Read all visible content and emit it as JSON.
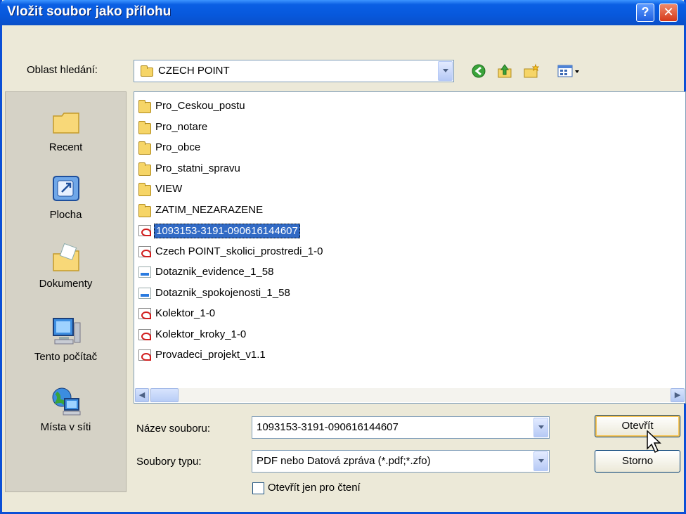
{
  "window": {
    "title": "Vložit soubor jako přílohu",
    "help_glyph": "?",
    "close_glyph": "✕"
  },
  "lookin": {
    "label": "Oblast hledání:",
    "value": "CZECH POINT"
  },
  "toolbar": {
    "icons": [
      "back-icon",
      "up-folder-icon",
      "new-folder-icon",
      "view-menu-icon"
    ]
  },
  "places": [
    {
      "label": "Recent",
      "icon": "recent-folder-icon"
    },
    {
      "label": "Plocha",
      "icon": "desktop-icon"
    },
    {
      "label": "Dokumenty",
      "icon": "documents-folder-icon"
    },
    {
      "label": "Tento počítač",
      "icon": "computer-icon"
    },
    {
      "label": "Místa v síti",
      "icon": "network-icon"
    }
  ],
  "files": [
    {
      "name": "Pro_Ceskou_postu",
      "type": "folder"
    },
    {
      "name": "Pro_notare",
      "type": "folder"
    },
    {
      "name": "Pro_obce",
      "type": "folder"
    },
    {
      "name": "Pro_statni_spravu",
      "type": "folder"
    },
    {
      "name": "VIEW",
      "type": "folder"
    },
    {
      "name": "ZATIM_NEZARAZENE",
      "type": "folder"
    },
    {
      "name": "1093153-3191-090616144607",
      "type": "pdf",
      "selected": true
    },
    {
      "name": "Czech POINT_skolici_prostredi_1-0",
      "type": "pdf"
    },
    {
      "name": "Dotaznik_evidence_1_58",
      "type": "zfo"
    },
    {
      "name": "Dotaznik_spokojenosti_1_58",
      "type": "zfo"
    },
    {
      "name": "Kolektor_1-0",
      "type": "pdf"
    },
    {
      "name": "Kolektor_kroky_1-0",
      "type": "pdf"
    },
    {
      "name": "Provadeci_projekt_v1.1",
      "type": "pdf"
    }
  ],
  "filename": {
    "label": "Název souboru:",
    "value": "1093153-3191-090616144607"
  },
  "filetype": {
    "label": "Soubory typu:",
    "value": "PDF nebo  Datová zpráva (*.pdf;*.zfo)"
  },
  "readonly": {
    "label": "Otevřít jen pro čtení",
    "checked": false
  },
  "buttons": {
    "open": "Otevřít",
    "cancel": "Storno"
  },
  "colors": {
    "titlebar": "#0a5fe4",
    "selection": "#316ac5",
    "face": "#ece9d8"
  }
}
